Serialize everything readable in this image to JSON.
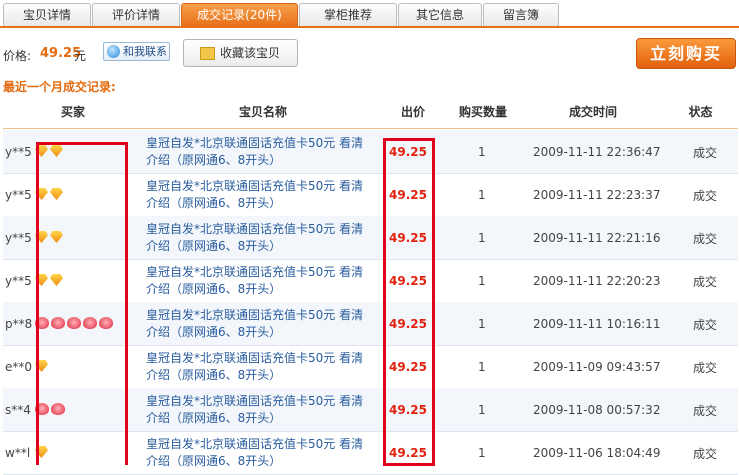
{
  "tabs": [
    "宝贝详情",
    "评价详情",
    "成交记录(20件)",
    "掌柜推荐",
    "其它信息",
    "留言簿"
  ],
  "active_tab": 2,
  "price": {
    "label": "价格:",
    "value": "49.25",
    "unit": "元"
  },
  "contact_label": "和我联系",
  "favorite_label": "收藏该宝贝",
  "buy_label": "立刻购买",
  "recent_title": "最近一个月成交记录:",
  "columns": {
    "buyer": "买家",
    "item": "宝贝名称",
    "price": "出价",
    "qty": "购买数量",
    "time": "成交时间",
    "status": "状态"
  },
  "rows": [
    {
      "buyer": "y**5",
      "badge": "gem",
      "badge_count": 2,
      "item_line1": "皇冠自发*北京联通固话充值卡50元 看清",
      "item_line2": "介绍（原网通6、8开头）",
      "price": "49.25",
      "qty": "1",
      "time": "2009-11-11 22:36:47",
      "status": "成交"
    },
    {
      "buyer": "y**5",
      "badge": "gem",
      "badge_count": 2,
      "item_line1": "皇冠自发*北京联通固话充值卡50元 看清",
      "item_line2": "介绍（原网通6、8开头）",
      "price": "49.25",
      "qty": "1",
      "time": "2009-11-11 22:23:37",
      "status": "成交"
    },
    {
      "buyer": "y**5",
      "badge": "gem",
      "badge_count": 2,
      "item_line1": "皇冠自发*北京联通固话充值卡50元 看清",
      "item_line2": "介绍（原网通6、8开头）",
      "price": "49.25",
      "qty": "1",
      "time": "2009-11-11 22:21:16",
      "status": "成交"
    },
    {
      "buyer": "y**5",
      "badge": "gem",
      "badge_count": 2,
      "item_line1": "皇冠自发*北京联通固话充值卡50元 看清",
      "item_line2": "介绍（原网通6、8开头）",
      "price": "49.25",
      "qty": "1",
      "time": "2009-11-11 22:20:23",
      "status": "成交"
    },
    {
      "buyer": "p**8",
      "badge": "heart",
      "badge_count": 5,
      "item_line1": "皇冠自发*北京联通固话充值卡50元 看清",
      "item_line2": "介绍（原网通6、8开头）",
      "price": "49.25",
      "qty": "1",
      "time": "2009-11-11 10:16:11",
      "status": "成交"
    },
    {
      "buyer": "e**0",
      "badge": "gem",
      "badge_count": 1,
      "item_line1": "皇冠自发*北京联通固话充值卡50元 看清",
      "item_line2": "介绍（原网通6、8开头）",
      "price": "49.25",
      "qty": "1",
      "time": "2009-11-09 09:43:57",
      "status": "成交"
    },
    {
      "buyer": "s**4",
      "badge": "heart",
      "badge_count": 2,
      "item_line1": "皇冠自发*北京联通固话充值卡50元 看清",
      "item_line2": "介绍（原网通6、8开头）",
      "price": "49.25",
      "qty": "1",
      "time": "2009-11-08 00:57:32",
      "status": "成交"
    },
    {
      "buyer": "w**l",
      "badge": "gem",
      "badge_count": 1,
      "item_line1": "皇冠自发*北京联通固话充值卡50元 看清",
      "item_line2": "介绍（原网通6、8开头）",
      "price": "49.25",
      "qty": "1",
      "time": "2009-11-06 18:04:49",
      "status": "成交"
    }
  ],
  "colors": {
    "accent": "#e8701a",
    "price_red": "#e2220f",
    "link_blue": "#2a5d9f",
    "highlight_box": "#e1001c"
  }
}
